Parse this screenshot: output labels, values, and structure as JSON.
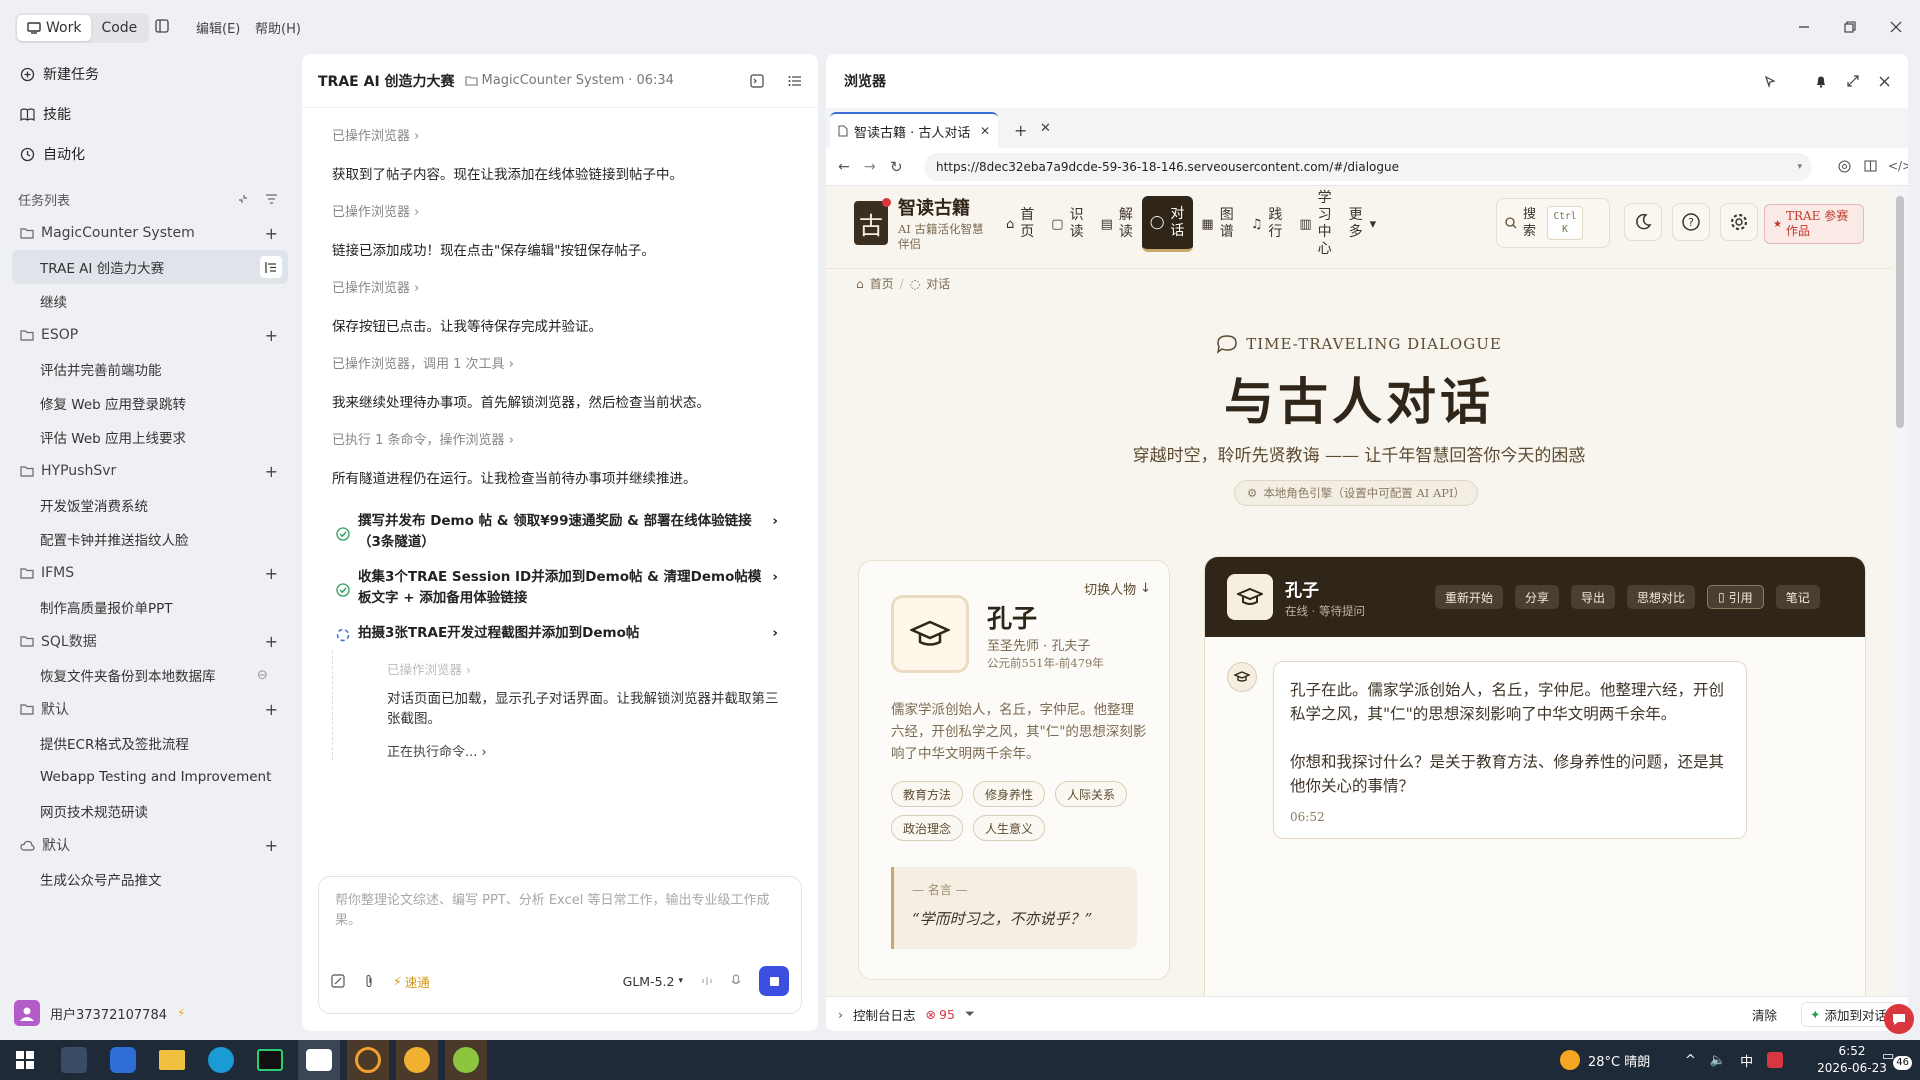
{
  "titlebar": {
    "modes": [
      {
        "label": "Work"
      },
      {
        "label": "Code"
      }
    ],
    "menus": [
      "编辑(E)",
      "帮助(H)"
    ]
  },
  "sidebar": {
    "top_items": [
      {
        "label": "新建任务",
        "icon": "plus-circle-icon"
      },
      {
        "label": "技能",
        "icon": "book-icon"
      },
      {
        "label": "自动化",
        "icon": "clock-icon"
      }
    ],
    "section_label": "任务列表",
    "projects": [
      {
        "name": "MagicCounter System",
        "icon": "folder-icon",
        "tasks": [
          "TRAE AI 创造力大赛",
          "继续"
        ]
      },
      {
        "name": "ESOP",
        "icon": "folder-icon",
        "tasks": [
          "评估并完善前端功能",
          "修复 Web 应用登录跳转",
          "评估 Web 应用上线要求"
        ]
      },
      {
        "name": "HYPushSvr",
        "icon": "folder-icon",
        "tasks": [
          "开发饭堂消费系统",
          "配置卡钟并推送指纹人脸"
        ]
      },
      {
        "name": "IFMS",
        "icon": "folder-icon",
        "tasks": [
          "制作高质量报价单PPT"
        ]
      },
      {
        "name": "SQL数据",
        "icon": "folder-icon",
        "tasks": [
          "恢复文件夹备份到本地数据库"
        ]
      },
      {
        "name": "默认",
        "icon": "folder-icon",
        "tasks": [
          "提供ECR格式及签批流程",
          "Webapp Testing and Improvement Pl...",
          "网页技术规范研读"
        ]
      },
      {
        "name": "默认",
        "icon": "cloud-icon",
        "tasks": [
          "生成公众号产品推文"
        ]
      }
    ],
    "user": "用户37372107784"
  },
  "chat": {
    "title": "TRAE AI 创造力大赛",
    "project": "MagicCounter System",
    "time": "06:34",
    "messages": [
      {
        "kind": "op",
        "text": "已操作浏览器"
      },
      {
        "kind": "text",
        "text": "获取到了帖子内容。现在让我添加在线体验链接到帖子中。"
      },
      {
        "kind": "op",
        "text": "已操作浏览器"
      },
      {
        "kind": "text",
        "text": "链接已添加成功！现在点击\"保存编辑\"按钮保存帖子。"
      },
      {
        "kind": "op",
        "text": "已操作浏览器"
      },
      {
        "kind": "text",
        "text": "保存按钮已点击。让我等待保存完成并验证。"
      },
      {
        "kind": "op",
        "text": "已操作浏览器，调用 1 次工具"
      },
      {
        "kind": "text",
        "text": "我来继续处理待办事项。首先解锁浏览器，然后检查当前状态。"
      },
      {
        "kind": "op",
        "text": "已执行 1 条命令，操作浏览器"
      },
      {
        "kind": "text",
        "text": "所有隧道进程仍在运行。让我检查当前待办事项并继续推进。"
      }
    ],
    "todos": [
      {
        "status": "done",
        "text": "撰写并发布 Demo 帖 & 领取¥99速通奖励 & 部署在线体验链接（3条隧道）"
      },
      {
        "status": "done",
        "text": "收集3个TRAE Session ID并添加到Demo帖 & 清理Demo帖模板文字 + 添加备用体验链接"
      },
      {
        "status": "running",
        "text": "拍摄3张TRAE开发过程截图并添加到Demo帖"
      }
    ],
    "sub": {
      "op": "已操作浏览器",
      "text": "对话页面已加载，显示孔子对话界面。让我解锁浏览器并截取第三张截图。",
      "running": "正在执行命令..."
    },
    "input_placeholder": "帮你整理论文综述、编写 PPT、分析 Excel 等日常工作，输出专业级工作成果。",
    "speed_label": "速通",
    "model": "GLM-5.2"
  },
  "browser": {
    "title": "浏览器",
    "tab_title": "智读古籍 · 古人对话",
    "url": "https://8dec32eba7a9dcde-59-36-18-146.serveousercontent.com/#/dialogue",
    "console_label": "控制台日志",
    "error_count": "95",
    "clear_label": "清除",
    "add_to_chat": "添加到对话"
  },
  "site": {
    "logo_char": "古",
    "brand": "智读古籍",
    "tagline": "AI 古籍活化智慧伴侣",
    "nav": [
      {
        "label": "首页",
        "icon": "home-icon"
      },
      {
        "label": "识读",
        "icon": "book-open-icon"
      },
      {
        "label": "解读",
        "icon": "document-icon"
      },
      {
        "label": "对话",
        "icon": "chat-icon"
      },
      {
        "label": "图谱",
        "icon": "map-icon"
      },
      {
        "label": "践行",
        "icon": "music-icon"
      },
      {
        "label": "学习中心",
        "icon": "chart-icon"
      },
      {
        "label": "更多",
        "icon": "chevron-down-icon"
      }
    ],
    "search_label": "搜索",
    "search_kbd": "Ctrl K",
    "trae_badge": "TRAE 参赛作品",
    "breadcrumb": [
      "首页",
      "对话"
    ],
    "eyebrow": "TIME-TRAVELING DIALOGUE",
    "heading": "与古人对话",
    "subheading": "穿越时空，聆听先贤教诲 —— 让千年智慧回答你今天的困惑",
    "engine_badge": "本地角色引擎（设置中可配置 AI API）",
    "sage": {
      "switch_label": "切换人物",
      "name": "孔子",
      "title": "至圣先师 · 孔夫子",
      "dates": "公元前551年-前479年",
      "bio": "儒家学派创始人，名丘，字仲尼。他整理六经，开创私学之风，其\"仁\"的思想深刻影响了中华文明两千余年。",
      "tags": [
        "教育方法",
        "修身养性",
        "人际关系",
        "政治理念",
        "人生意义"
      ],
      "quote_label": "— 名言 —",
      "quote": "“学而时习之，不亦说乎？”"
    },
    "dialogue": {
      "name": "孔子",
      "status": "在线 · 等待提问",
      "actions": [
        "重新开始",
        "分享",
        "导出",
        "思想对比",
        "引用",
        "笔记"
      ],
      "message_p1": "孔子在此。儒家学派创始人，名丘，字仲尼。他整理六经，开创私学之风，其\"仁\"的思想深刻影响了中华文明两千余年。",
      "message_p2": "你想和我探讨什么？是关于教育方法、修身养性的问题，还是其他你关心的事情？",
      "message_time": "06:52"
    }
  },
  "taskbar": {
    "weather": "28°C 晴朗",
    "ime": "中",
    "time": "6:52",
    "date": "2026-06-23",
    "notifications": "46"
  },
  "colors": {
    "accent_blue": "#3b6fd8",
    "brown_dark": "#2f2619",
    "paper": "#f8f5ef",
    "success": "#2e9e5b",
    "error": "#d9363e",
    "stop_button": "#3d4fe0"
  }
}
